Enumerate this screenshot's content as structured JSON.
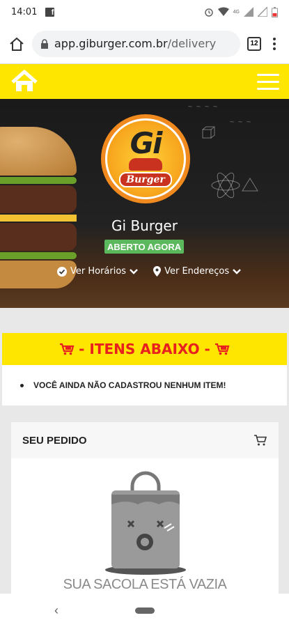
{
  "status": {
    "time": "14:01",
    "fb": "f",
    "network": "4G"
  },
  "browser": {
    "domain": "app.giburger.com.br",
    "path": "/delivery",
    "tab_count": "12"
  },
  "store": {
    "name": "Gi Burger",
    "status": "ABERTO AGORA",
    "logo_gi": "Gi",
    "logo_burger": "Burger"
  },
  "links": {
    "hours": "Ver Horários",
    "addresses": "Ver Endereços"
  },
  "items": {
    "header": "- ITENS ABAIXO -",
    "empty_message": "VOCÊ AINDA NÃO CADASTROU NENHUM ITEM!"
  },
  "order": {
    "title": "SEU PEDIDO",
    "empty_bag": "SUA SACOLA ESTÁ VAZIA"
  },
  "colors": {
    "yellow": "#ffe600",
    "red": "#e8201e",
    "green": "#5cb85c"
  }
}
